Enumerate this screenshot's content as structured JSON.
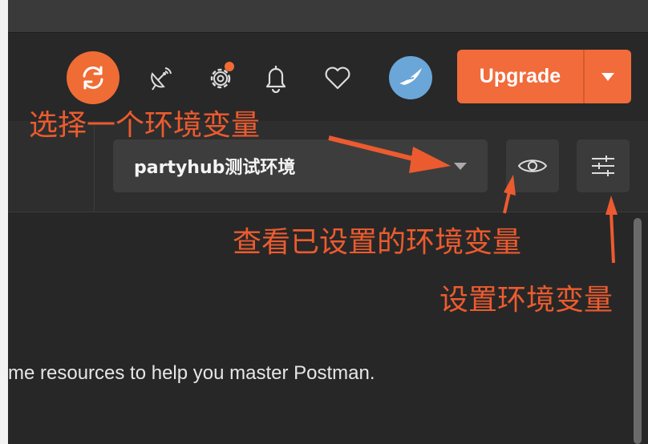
{
  "toolbar": {
    "sync_icon": "sync-icon",
    "satellite_icon": "satellite-icon",
    "settings_icon": "gear-icon",
    "notification_icon": "bell-icon",
    "heart_icon": "heart-icon",
    "upgrade_label": "Upgrade",
    "accent_color": "#f26b3a"
  },
  "environment": {
    "selected": "partyhub测试环境"
  },
  "content": {
    "welcome_text": "me resources to help you master Postman."
  },
  "annotations": {
    "select_env": "选择一个环境变量",
    "view_env": "查看已设置的环境变量",
    "set_env": "设置环境变量",
    "color": "#ec5b2f"
  }
}
